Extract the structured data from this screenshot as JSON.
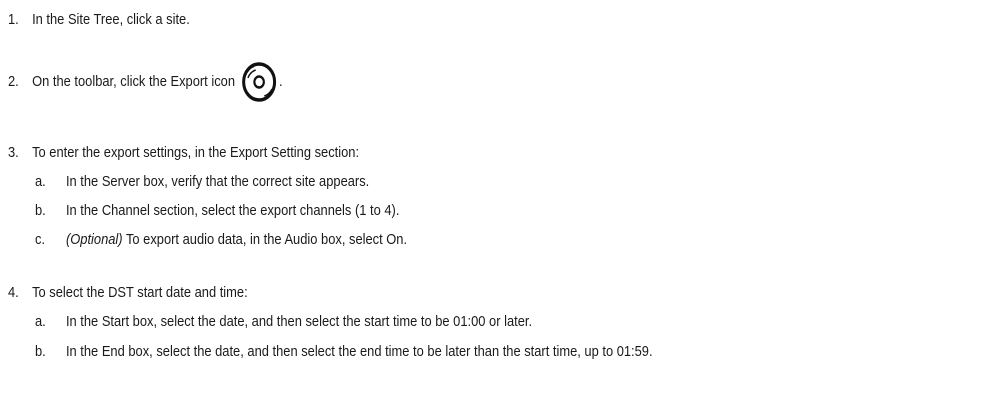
{
  "steps": [
    {
      "number": "1.",
      "text": "In the Site Tree, click a site."
    },
    {
      "number": "2.",
      "text_before": "On the toolbar, click the Export icon",
      "icon": "export-disc-icon",
      "text_after": "."
    },
    {
      "number": "3.",
      "text": "To enter the export settings, in the Export Setting section:",
      "substeps": [
        {
          "letter": "a.",
          "text": "In the Server box, verify that the correct site appears."
        },
        {
          "letter": "b.",
          "text": "In the Channel section, select the export channels (1 to 4)."
        },
        {
          "letter": "c.",
          "italic": "(Optional)",
          "text": " To export audio data, in the Audio box, select On."
        }
      ]
    },
    {
      "number": "4.",
      "text": "To select the DST start date and time:",
      "substeps": [
        {
          "letter": "a.",
          "text": "In the Start box, select the date, and then select the start time to be 01:00 or later."
        },
        {
          "letter": "b.",
          "text": "In the End box, select the date, and then select the end time to be later than the start time, up to 01:59."
        }
      ]
    }
  ]
}
